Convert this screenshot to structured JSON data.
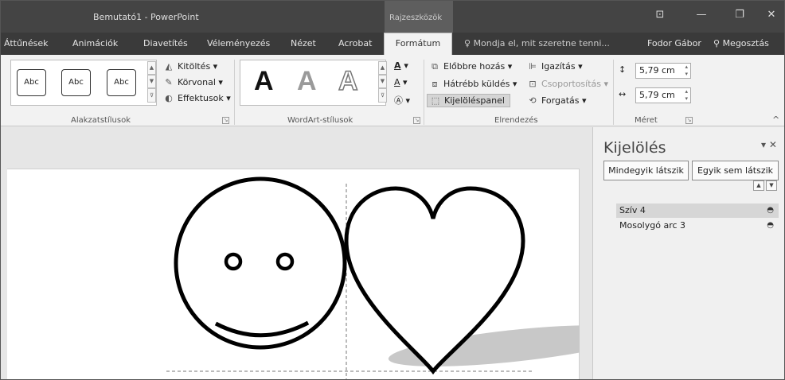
{
  "titlebar": {
    "title": "Bemutató1 - PowerPoint",
    "context_group": "Rajzeszközök",
    "btn_restore_box": "⊡",
    "btn_minimize": "—",
    "btn_maximize": "❐",
    "btn_close": "✕"
  },
  "tabs": {
    "transitions": "Áttűnések",
    "animations": "Animációk",
    "slideshow": "Diavetítés",
    "review": "Véleményezés",
    "view": "Nézet",
    "acrobat": "Acrobat",
    "format": "Formátum",
    "tell_me": "Mondja el, mit szeretne tenni...",
    "user": "Fodor Gábor",
    "share": "Megosztás"
  },
  "ribbon": {
    "shape_styles": {
      "label": "Alakzatstílusok",
      "presets": [
        "Abc",
        "Abc",
        "Abc"
      ],
      "fill": "Kitöltés",
      "outline": "Körvonal",
      "effects": "Effektusok"
    },
    "wordart": {
      "label": "WordArt-stílusok",
      "letters": [
        "A",
        "A",
        "A"
      ]
    },
    "arrange": {
      "label": "Elrendezés",
      "bring_forward": "Előbbre hozás",
      "send_backward": "Hátrébb küldés",
      "selection_pane": "Kijelöléspanel",
      "align": "Igazítás",
      "group": "Csoportosítás",
      "rotate": "Forgatás"
    },
    "size": {
      "label": "Méret",
      "height": "5,79 cm",
      "width": "5,79 cm"
    }
  },
  "selection_pane": {
    "title": "Kijelölés",
    "show_all": "Mindegyik látszik",
    "hide_all": "Egyik sem látszik",
    "items": [
      {
        "name": "Szív 4",
        "selected": true
      },
      {
        "name": "Mosolygó arc 3",
        "selected": false
      }
    ]
  },
  "icons": {
    "tell_me": "lightbulb-icon",
    "share": "person-icon",
    "visible": "eye-icon"
  }
}
